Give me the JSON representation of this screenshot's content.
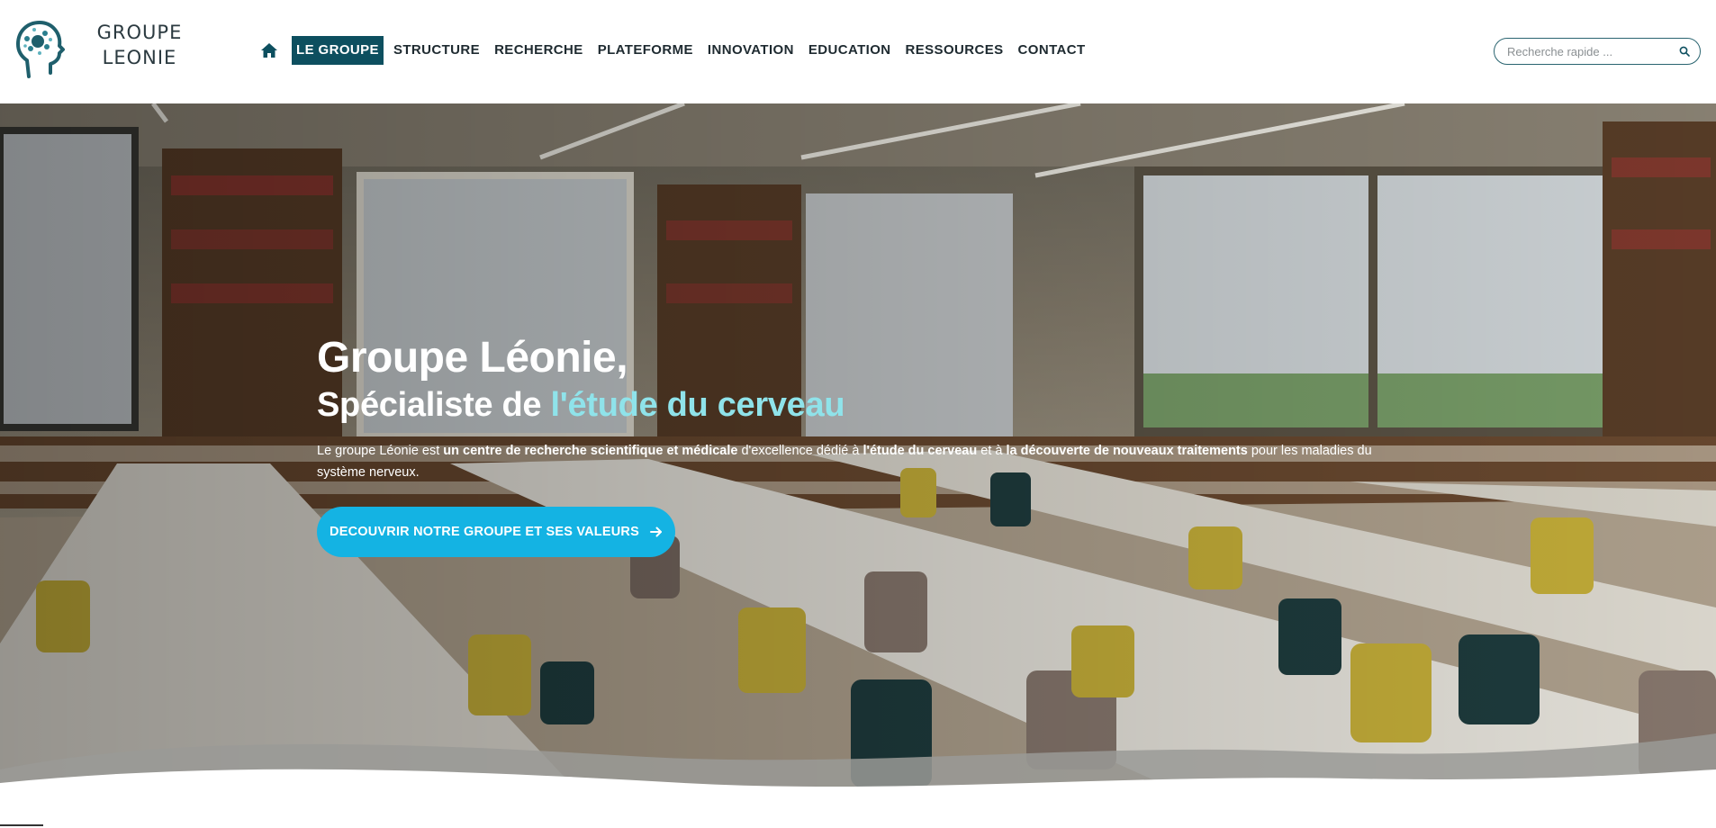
{
  "brand": {
    "line1": "GROUPE",
    "line2": "LEONIE",
    "colors": {
      "primary": "#0d4f5f",
      "accent": "#14b3e3",
      "highlight": "#8fe3ea"
    }
  },
  "nav": {
    "home_icon": "home-icon",
    "items": [
      {
        "label": "LE GROUPE",
        "active": true
      },
      {
        "label": "STRUCTURE",
        "active": false
      },
      {
        "label": "RECHERCHE",
        "active": false
      },
      {
        "label": "PLATEFORME",
        "active": false
      },
      {
        "label": "INNOVATION",
        "active": false
      },
      {
        "label": "EDUCATION",
        "active": false
      },
      {
        "label": "RESSOURCES",
        "active": false
      },
      {
        "label": "CONTACT",
        "active": false
      }
    ]
  },
  "search": {
    "placeholder": "Recherche rapide ...",
    "icon": "search-icon"
  },
  "hero": {
    "title": "Groupe Léonie,",
    "subtitle_prefix": "Spécialiste de ",
    "subtitle_accent": "l'étude du cerveau",
    "description": {
      "p1": "Le groupe Léonie est ",
      "b1": "un centre de recherche scientifique et médicale",
      "p2": " d'excellence dédié à ",
      "b2": "l'étude du cerveau",
      "p3": " et à ",
      "b3": "la découverte de nouveaux traitements",
      "p4": " pour les maladies du système nerveux."
    },
    "cta_label": "DECOUVRIR NOTRE GROUPE ET SES VALEURS",
    "cta_icon": "arrow-right-icon"
  }
}
